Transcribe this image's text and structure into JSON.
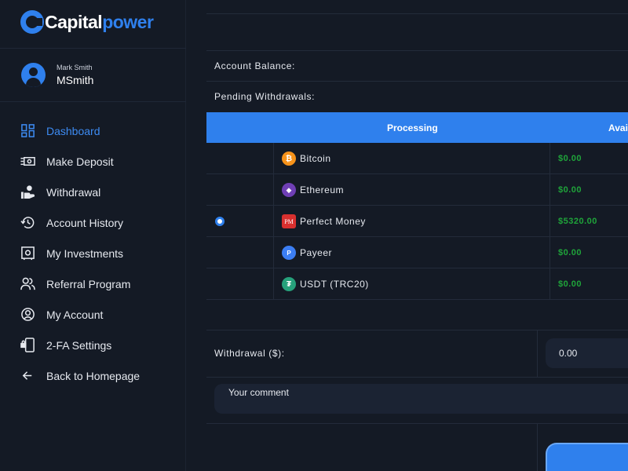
{
  "brand": {
    "name_part1": "Capital",
    "name_part2": "power"
  },
  "user": {
    "full_name": "Mark Smith",
    "login": "MSmith"
  },
  "nav": [
    {
      "label": "Dashboard",
      "icon": "dashboard-icon",
      "active": true
    },
    {
      "label": "Make Deposit",
      "icon": "cash-icon"
    },
    {
      "label": "Withdrawal",
      "icon": "hand-coin-icon"
    },
    {
      "label": "Account History",
      "icon": "history-icon"
    },
    {
      "label": "My Investments",
      "icon": "safe-icon"
    },
    {
      "label": "Referral Program",
      "icon": "users-icon"
    },
    {
      "label": "My Account",
      "icon": "account-circle-icon"
    },
    {
      "label": "2-FA Settings",
      "icon": "phone-lock-icon"
    },
    {
      "label": "Back to Homepage",
      "icon": "arrow-left-icon"
    }
  ],
  "account": {
    "balance_label": "Account Balance:",
    "pending_label": "Pending Withdrawals:"
  },
  "table": {
    "headers": {
      "processing": "Processing",
      "available": "Avai"
    },
    "rows": [
      {
        "name": "Bitcoin",
        "icon": "bitcoin-icon",
        "icon_glyph": "₿",
        "color": "#f7931a",
        "amount": "$0.00",
        "selected": false
      },
      {
        "name": "Ethereum",
        "icon": "ethereum-icon",
        "icon_glyph": "◆",
        "color": "#6f3fb5",
        "amount": "$0.00",
        "selected": false
      },
      {
        "name": "Perfect Money",
        "icon": "perfect-money-icon",
        "icon_glyph": "PM",
        "color": "#d8302f",
        "amount": "$5320.00",
        "selected": true
      },
      {
        "name": "Payeer",
        "icon": "payeer-icon",
        "icon_glyph": "P",
        "color": "#3c7ef3",
        "amount": "$0.00",
        "selected": false
      },
      {
        "name": "USDT (TRC20)",
        "icon": "tether-icon",
        "icon_glyph": "₮",
        "color": "#26a17b",
        "amount": "$0.00",
        "selected": false
      }
    ]
  },
  "form": {
    "withdrawal_label": "Withdrawal ($):",
    "withdrawal_value": "0.00",
    "comment_placeholder": "Your comment"
  },
  "colors": {
    "accent": "#2f80ed",
    "background": "#141a25",
    "amount_green": "#1fa43a"
  }
}
